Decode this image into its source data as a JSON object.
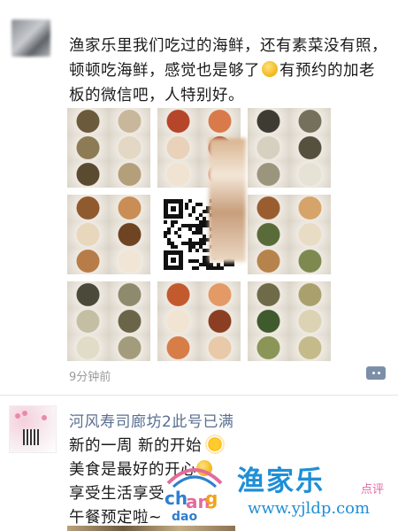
{
  "post": {
    "text_part1": "渔家乐里我们吃过的海鲜，还有素菜没有照，顿顿吃海鲜，感觉也是够了",
    "text_part2": "有预约的加老板的微信吧，人特别好。",
    "time": "9分钟前"
  },
  "post2": {
    "author": "河风寿司廊坊2此号已满",
    "lines": [
      "新的一周 新的开始",
      "美食是最好的开心",
      "享受生活享受",
      "午餐预定啦~"
    ]
  },
  "watermark": {
    "brand": "渔家乐",
    "sub": "点评",
    "url": "www.yjldp.com"
  },
  "icons": {
    "post_emoji": "grin-sweat-emoji",
    "sun": "sun-emoji",
    "smile": "smile-emoji",
    "more": "more-dots-icon"
  },
  "colors": {
    "author_name": "#5a6f92",
    "time": "#9a9a9a",
    "more_button": "#7b8fa8",
    "watermark_blue": "#1f8fd6",
    "watermark_pink": "#e26aa0"
  }
}
